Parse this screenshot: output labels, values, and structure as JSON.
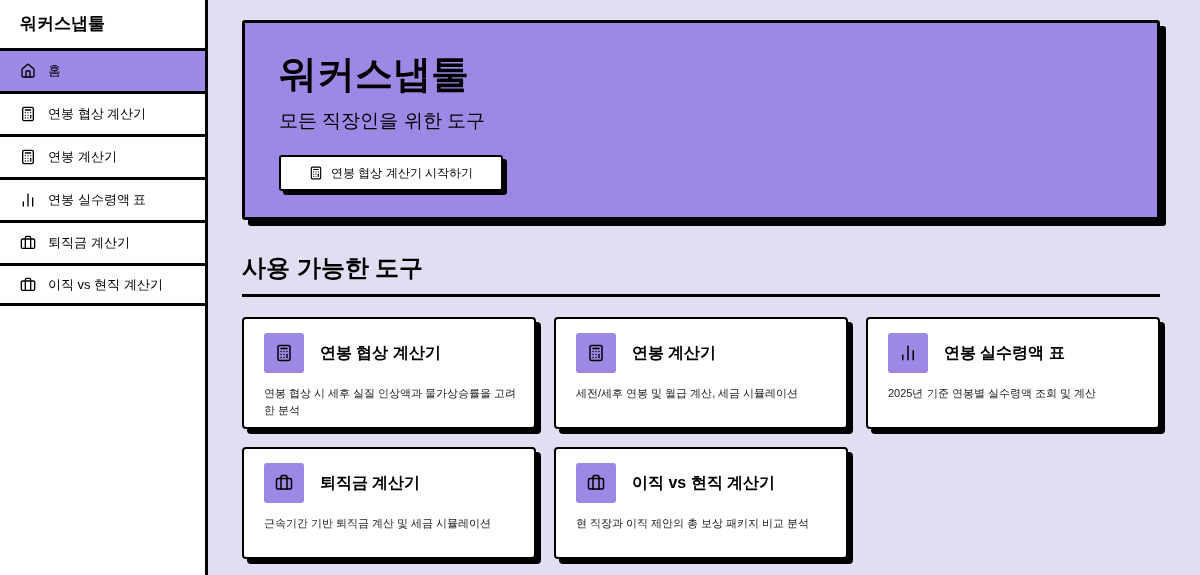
{
  "sidebar": {
    "title": "워커스냅툴",
    "items": [
      {
        "label": "홈",
        "kind": "home",
        "selected": true
      },
      {
        "label": "연봉 협상 계산기",
        "kind": "calculator",
        "selected": false
      },
      {
        "label": "연봉 계산기",
        "kind": "calculator",
        "selected": false
      },
      {
        "label": "연봉 실수령액 표",
        "kind": "chart",
        "selected": false
      },
      {
        "label": "퇴직금 계산기",
        "kind": "briefcase",
        "selected": false
      },
      {
        "label": "이직 vs 현직 계산기",
        "kind": "briefcase",
        "selected": false
      }
    ]
  },
  "hero": {
    "title": "워커스냅툴",
    "subtitle": "모든 직장인을 위한 도구",
    "button": {
      "label": "연봉 협상 계산기 시작하기",
      "kind": "calculator"
    }
  },
  "section": {
    "title": "사용 가능한 도구",
    "cards": [
      {
        "title": "연봉 협상 계산기",
        "description": "연봉 협상 시 세후 실질 인상액과 물가상승률을 고려한 분석",
        "kind": "calculator"
      },
      {
        "title": "연봉 계산기",
        "description": "세전/세후 연봉 및 월급 계산, 세금 시뮬레이션",
        "kind": "calculator"
      },
      {
        "title": "연봉 실수령액 표",
        "description": "2025년 기준 연봉별 실수령액 조회 및 계산",
        "kind": "chart"
      },
      {
        "title": "퇴직금 계산기",
        "description": "근속기간 기반 퇴직금 계산 및 세금 시뮬레이션",
        "kind": "briefcase"
      },
      {
        "title": "이직 vs 현직 계산기",
        "description": "현 직장과 이직 제안의 총 보상 패키지 비교 분석",
        "kind": "briefcase"
      }
    ]
  }
}
